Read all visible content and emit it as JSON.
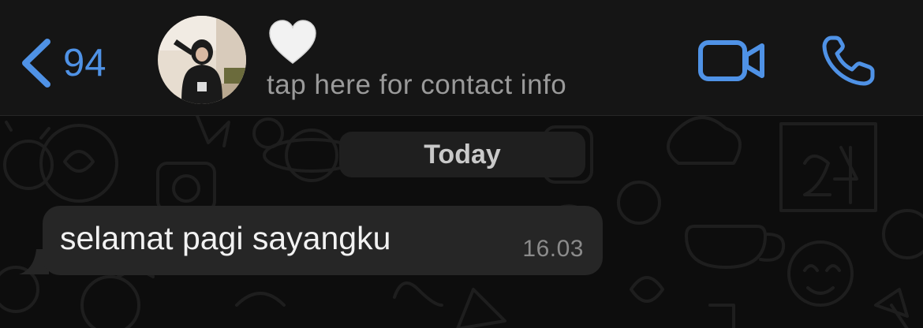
{
  "header": {
    "back_count": "94",
    "contact_emoji": "white-heart",
    "subtitle": "tap here for contact info",
    "accent_color": "#4f92e6"
  },
  "conversation": {
    "date_separator": "Today",
    "messages": [
      {
        "direction": "incoming",
        "text": "selamat pagi sayangku",
        "time": "16.03"
      }
    ]
  },
  "theme": {
    "header_bg": "#151515",
    "bubble_incoming_bg": "#262626",
    "wallpaper_bg": "#0d0d0d"
  }
}
